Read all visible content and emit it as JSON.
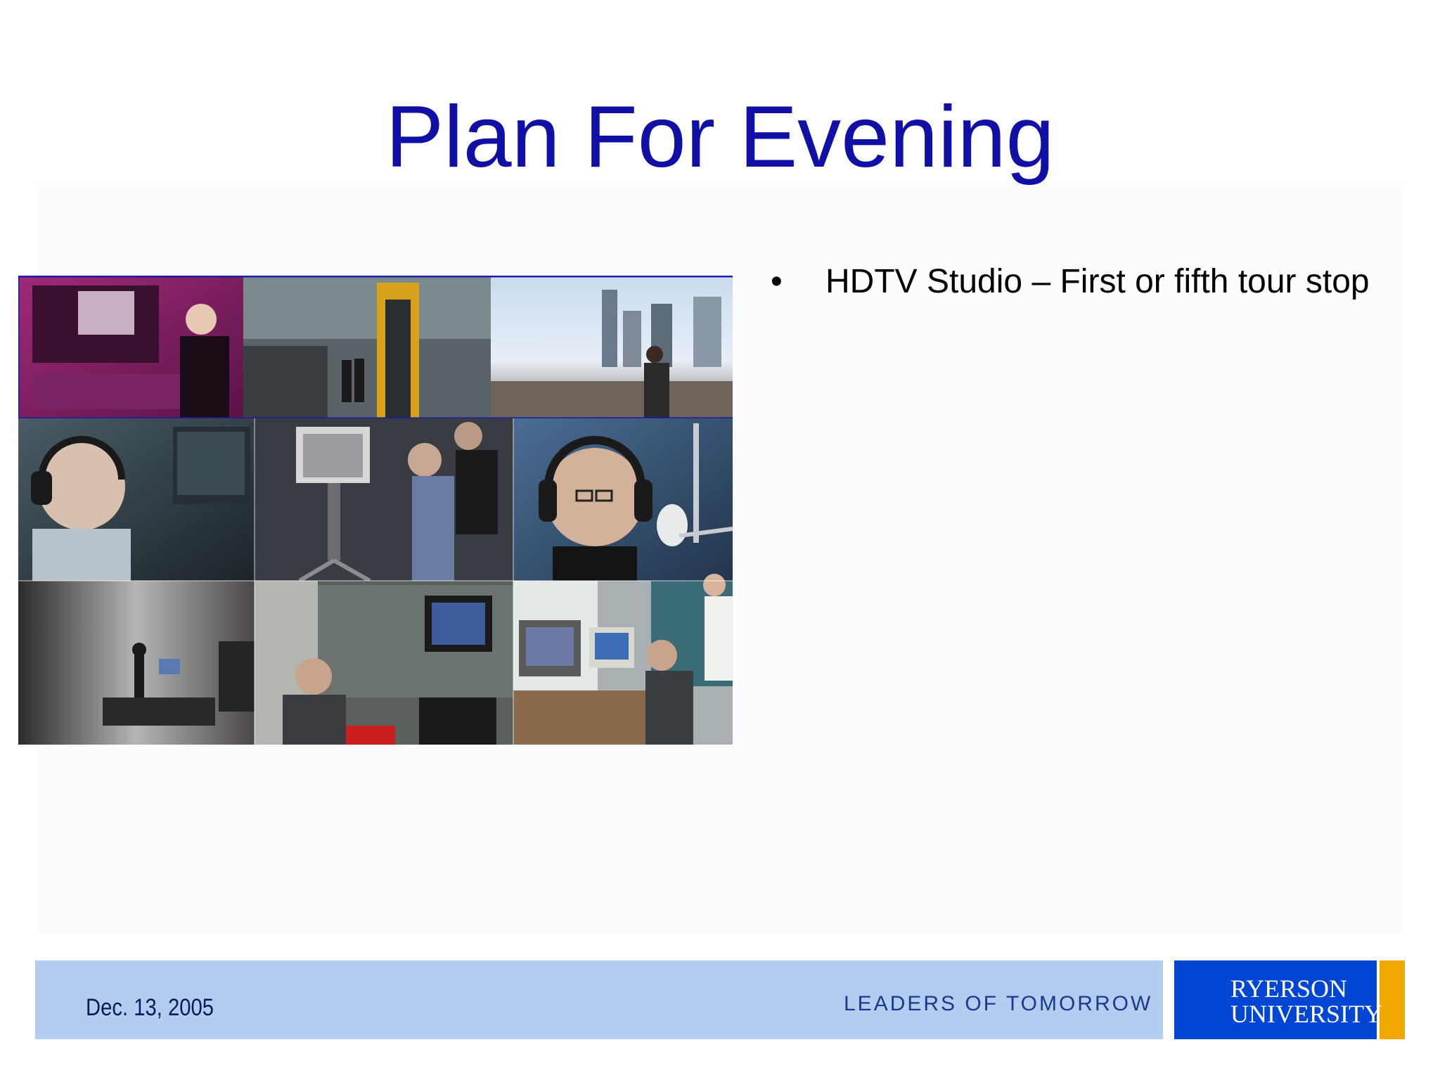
{
  "slide": {
    "title": "Plan For Evening",
    "bullets": [
      "HDTV Studio – First or fifth tour stop"
    ]
  },
  "collage": {
    "panels": [
      "control-room-operator",
      "building-atrium",
      "city-street",
      "headset-operator",
      "studio-camera-operators",
      "audio-booth-announcer",
      "film-set",
      "classroom-monitor",
      "editing-suite"
    ]
  },
  "footer": {
    "date": "Dec. 13, 2005",
    "tagline": "LEADERS OF TOMORROW",
    "logo_line1": "RYERSON",
    "logo_line2": "UNIVERSITY"
  },
  "colors": {
    "title": "#1010a6",
    "footer_bar": "#b3cdf0",
    "logo_blue": "#0046d4",
    "logo_gold": "#f0a800"
  }
}
